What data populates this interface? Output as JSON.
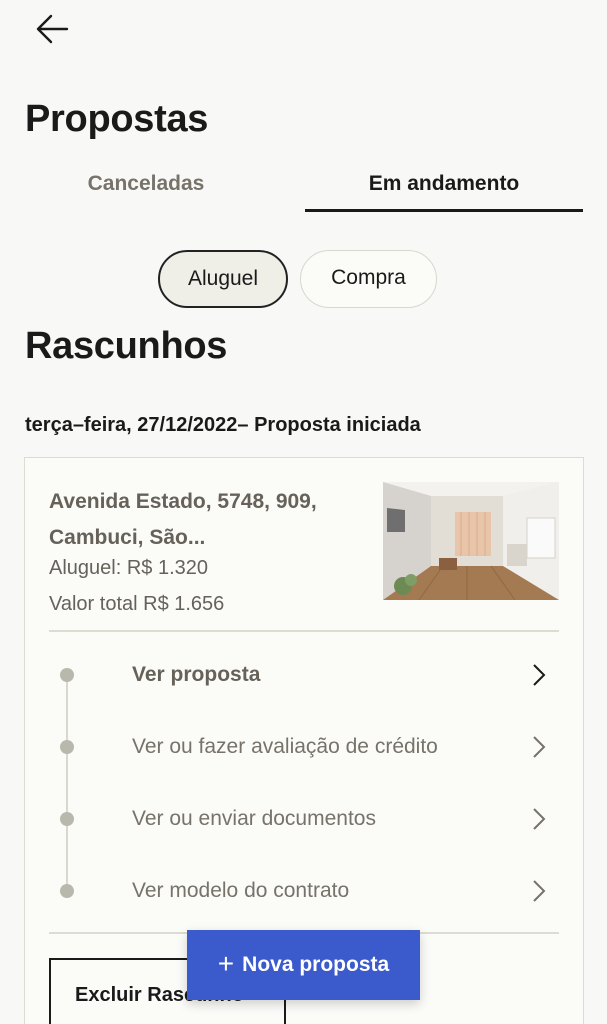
{
  "header": {
    "back_icon": "arrow-left-icon",
    "title": "Propostas"
  },
  "tabs": [
    {
      "label": "Canceladas",
      "active": false
    },
    {
      "label": "Em andamento",
      "active": true
    }
  ],
  "filters": [
    {
      "label": "Aluguel",
      "selected": true
    },
    {
      "label": "Compra",
      "selected": false
    }
  ],
  "section": {
    "title": "Rascunhos",
    "date_line": "terça–feira, 27/12/2022– Proposta iniciada"
  },
  "card": {
    "address": "Avenida Estado, 5748, 909, Cambuci, São...",
    "rent": "Aluguel: R$ 1.320",
    "total": "Valor total R$ 1.656",
    "steps": [
      {
        "label": "Ver proposta",
        "icon": "chevron-right-icon"
      },
      {
        "label": "Ver ou fazer avaliação de crédito",
        "icon": "chevron-right-icon"
      },
      {
        "label": "Ver ou enviar documentos",
        "icon": "chevron-right-icon"
      },
      {
        "label": "Ver modelo do contrato",
        "icon": "chevron-right-icon"
      }
    ],
    "delete_label": "Excluir Rascunho"
  },
  "fab": {
    "icon": "plus-icon",
    "label": "Nova proposta"
  },
  "colors": {
    "accent": "#3b5bcc",
    "muted_text": "#66625a",
    "border": "#dcdcd3"
  }
}
